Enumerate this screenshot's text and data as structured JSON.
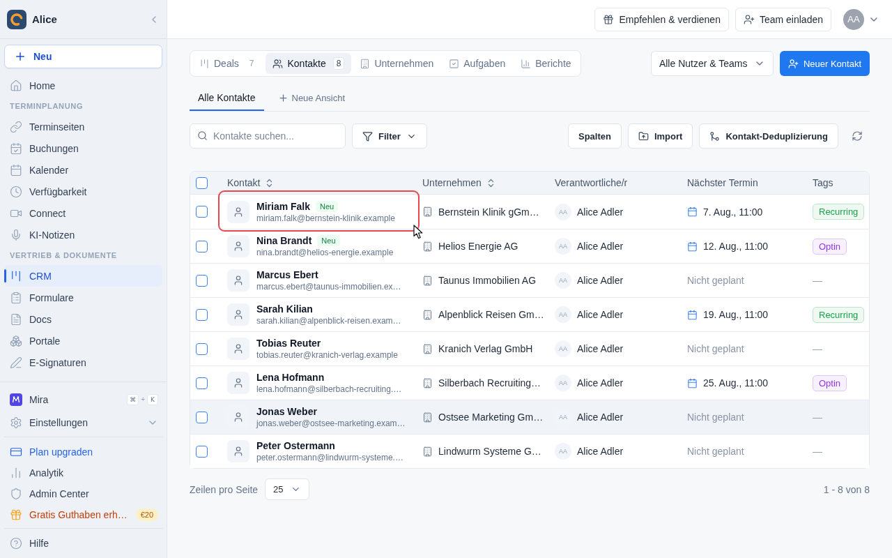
{
  "sidebar": {
    "workspace": {
      "name": "Alice"
    },
    "new_button": {
      "label": "Neu"
    },
    "nav": [
      {
        "kind": "item",
        "label": "Home",
        "selected": false
      },
      {
        "kind": "section",
        "label": "TERMINPLANUNG"
      },
      {
        "kind": "item",
        "label": "Terminseiten",
        "selected": false
      },
      {
        "kind": "item",
        "label": "Buchungen",
        "selected": false
      },
      {
        "kind": "item",
        "label": "Kalender",
        "selected": false
      },
      {
        "kind": "item",
        "label": "Verfügbarkeit",
        "selected": false
      },
      {
        "kind": "item",
        "label": "Connect",
        "selected": false
      },
      {
        "kind": "item",
        "label": "KI-Notizen",
        "selected": false
      },
      {
        "kind": "section",
        "label": "VERTRIEB & DOKUMENTE"
      },
      {
        "kind": "item",
        "label": "CRM",
        "selected": true
      },
      {
        "kind": "item",
        "label": "Formulare",
        "selected": false
      },
      {
        "kind": "item",
        "label": "Docs",
        "selected": false
      },
      {
        "kind": "item",
        "label": "Portale",
        "selected": false
      },
      {
        "kind": "item",
        "label": "E-Signaturen",
        "selected": false
      }
    ],
    "footer_groups": [
      [
        {
          "kind": "shortcut",
          "label": "Mira",
          "keys": [
            "⌘",
            "K"
          ],
          "joiner": "+"
        },
        {
          "kind": "expand",
          "label": "Einstellungen",
          "expanded": false
        }
      ],
      [
        {
          "kind": "upgrade",
          "label": "Plan upgraden"
        },
        {
          "kind": "plain",
          "label": "Analytik"
        },
        {
          "kind": "plain",
          "label": "Admin Center"
        },
        {
          "kind": "promo",
          "label": "Gratis Guthaben erh…",
          "badge": "€20"
        }
      ],
      [
        {
          "kind": "plain",
          "label": "Hilfe"
        }
      ]
    ]
  },
  "top_bar": {
    "buttons": [
      {
        "label": "Empfehlen & verdienen"
      },
      {
        "label": "Team einladen"
      }
    ],
    "account": {
      "initials": "AA"
    }
  },
  "module_tabs": [
    {
      "label": "Deals",
      "count": "7",
      "selected": false
    },
    {
      "label": "Kontakte",
      "count": "8",
      "selected": true
    },
    {
      "label": "Unternehmen",
      "selected": false
    },
    {
      "label": "Aufgaben",
      "selected": false
    },
    {
      "label": "Berichte",
      "selected": false
    }
  ],
  "owner_filter": {
    "value": "Alle Nutzer & Teams"
  },
  "primary_button": {
    "label": "Neuer Kontakt"
  },
  "views": [
    {
      "label": "Alle Kontakte",
      "selected": true
    }
  ],
  "add_view": {
    "label": "Neue Ansicht"
  },
  "toolbar": {
    "search": {
      "placeholder": "Kontakte suchen..."
    },
    "filter": {
      "label": "Filter"
    },
    "actions": [
      {
        "kind": "plain",
        "label": "Spalten"
      },
      {
        "kind": "import",
        "label": "Import"
      },
      {
        "kind": "merge",
        "label": "Kontakt-Deduplizierung"
      }
    ]
  },
  "table": {
    "select_all": {
      "checked": false
    },
    "columns": [
      {
        "label": "Kontakt",
        "sortable": true
      },
      {
        "label": "Unternehmen",
        "sortable": true
      },
      {
        "label": "Verantwortliche/r",
        "sortable": false
      },
      {
        "label": "Nächster Termin",
        "sortable": false
      },
      {
        "label": "Tags",
        "sortable": false
      }
    ],
    "rows": [
      {
        "checked": false,
        "hovered": false,
        "highlighted": true,
        "name": "Miriam Falk",
        "badge": "Neu",
        "email": "miriam.falk@bernstein-klinik.example",
        "company": "Bernstein Klinik gGm…",
        "owner": {
          "initials": "AA",
          "name": "Alice Adler"
        },
        "appointment": {
          "kind": "date",
          "text": "7. Aug., 11:00"
        },
        "tag": {
          "kind": "badge",
          "label": "Recurring",
          "color": "#16a34a"
        }
      },
      {
        "checked": false,
        "hovered": false,
        "highlighted": false,
        "name": "Nina Brandt",
        "badge": "Neu",
        "email": "nina.brandt@helios-energie.example",
        "company": "Helios Energie AG",
        "owner": {
          "initials": "AA",
          "name": "Alice Adler"
        },
        "appointment": {
          "kind": "date",
          "text": "12. Aug., 11:00"
        },
        "tag": {
          "kind": "badge",
          "label": "Optin",
          "color": "#9333ea"
        }
      },
      {
        "checked": false,
        "hovered": false,
        "highlighted": false,
        "name": "Marcus Ebert",
        "email": "marcus.ebert@taunus-immobilien.ex…",
        "company": "Taunus Immobilien AG",
        "owner": {
          "initials": "AA",
          "name": "Alice Adler"
        },
        "appointment": {
          "kind": "none",
          "text": "Nicht geplant"
        },
        "tag": {
          "kind": "none",
          "label": "—"
        }
      },
      {
        "checked": false,
        "hovered": false,
        "highlighted": false,
        "name": "Sarah Kilian",
        "email": "sarah.kilian@alpenblick-reisen.exam…",
        "company": "Alpenblick Reisen Gm…",
        "owner": {
          "initials": "AA",
          "name": "Alice Adler"
        },
        "appointment": {
          "kind": "date",
          "text": "19. Aug., 11:00"
        },
        "tag": {
          "kind": "badge",
          "label": "Recurring",
          "color": "#16a34a"
        }
      },
      {
        "checked": false,
        "hovered": false,
        "highlighted": false,
        "name": "Tobias Reuter",
        "email": "tobias.reuter@kranich-verlag.example",
        "company": "Kranich Verlag GmbH",
        "owner": {
          "initials": "AA",
          "name": "Alice Adler"
        },
        "appointment": {
          "kind": "none",
          "text": "Nicht geplant"
        },
        "tag": {
          "kind": "none",
          "label": "—"
        }
      },
      {
        "checked": false,
        "hovered": false,
        "highlighted": false,
        "name": "Lena Hofmann",
        "email": "lena.hofmann@silberbach-recruiting.…",
        "company": "Silberbach Recruiting…",
        "owner": {
          "initials": "AA",
          "name": "Alice Adler"
        },
        "appointment": {
          "kind": "date",
          "text": "25. Aug., 11:00"
        },
        "tag": {
          "kind": "badge",
          "label": "Optin",
          "color": "#9333ea"
        }
      },
      {
        "checked": false,
        "hovered": true,
        "highlighted": false,
        "name": "Jonas Weber",
        "email": "jonas.weber@ostsee-marketing.exam…",
        "company": "Ostsee Marketing Gm…",
        "owner": {
          "initials": "AA",
          "name": "Alice Adler"
        },
        "appointment": {
          "kind": "none",
          "text": "Nicht geplant"
        },
        "tag": {
          "kind": "none",
          "label": "—"
        }
      },
      {
        "checked": false,
        "hovered": false,
        "highlighted": false,
        "name": "Peter Ostermann",
        "email": "peter.ostermann@lindwurm-systeme.…",
        "company": "Lindwurm Systeme G…",
        "owner": {
          "initials": "AA",
          "name": "Alice Adler"
        },
        "appointment": {
          "kind": "none",
          "text": "Nicht geplant"
        },
        "tag": {
          "kind": "none",
          "label": "—"
        }
      }
    ]
  },
  "pagination": {
    "label": "Zeilen pro Seite",
    "page_size": "25",
    "range": "1 - 8 von 8"
  }
}
